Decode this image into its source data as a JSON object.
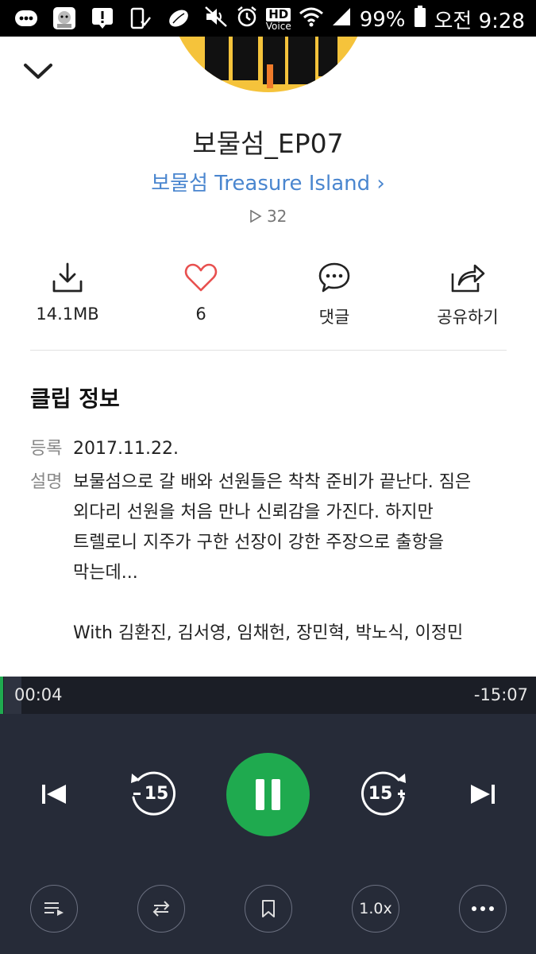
{
  "status_bar": {
    "battery": "99%",
    "time": "오전 9:28",
    "hd_label": "HD",
    "voice_label": "Voice"
  },
  "clip": {
    "title": "보물섬_EP07",
    "channel": "보물섬 Treasure Island",
    "channel_chevron": "›",
    "play_count": "32"
  },
  "actions": {
    "download_label": "14.1MB",
    "like_count": "6",
    "comment_label": "댓글",
    "share_label": "공유하기"
  },
  "info": {
    "section_title": "클립 정보",
    "registered_key": "등록",
    "registered_value": "2017.11.22.",
    "description_key": "설명",
    "description_lines": [
      "보물섬으로 갈 배와 선원들은 착착 준비가 끝난다. 짐은",
      "외다리 선원을 처음 만나 신뢰감을 가진다. 하지만",
      "트렐로니 지주가 구한 선장이 강한 주장으로 출항을",
      "막는데...",
      "",
      "With 김환진, 김서영, 임채헌, 장민혁, 박노식, 이정민"
    ]
  },
  "player": {
    "elapsed": "00:04",
    "remaining": "-15:07",
    "progress_fraction": 0.004,
    "rewind_label": "15",
    "forward_label": "15",
    "speed_label": "1.0x",
    "accent_color": "#1faa4f"
  }
}
